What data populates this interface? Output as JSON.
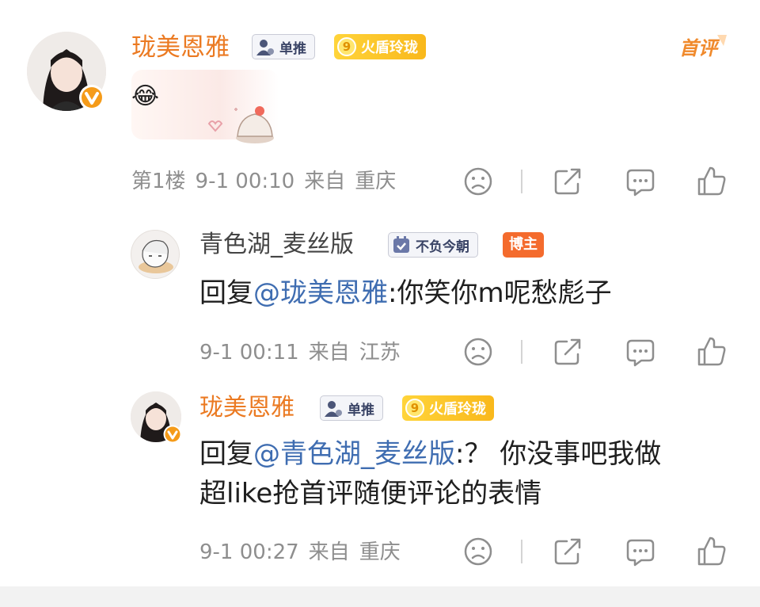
{
  "comment": {
    "username": "珑美恩雅",
    "badge_label": "单推",
    "fire_level": "9",
    "fire_label": "火盾玲珑",
    "first_tag": "首评",
    "emoji": "😂",
    "floor": "第1楼",
    "time": "9-1 00:10",
    "from_label": "来自",
    "location": "重庆"
  },
  "replies": [
    {
      "username": "青色湖_麦丝版",
      "badge_label": "不负今朝",
      "role_badge": "博主",
      "reply_prefix": "回复",
      "mention": "@珑美恩雅",
      "text": ":你笑你m呢愁彪子",
      "time": "9-1 00:11",
      "from_label": "来自",
      "location": "江苏"
    },
    {
      "username": "珑美恩雅",
      "badge_label": "单推",
      "fire_level": "9",
      "fire_label": "火盾玲珑",
      "reply_prefix": "回复",
      "mention": "@青色湖_麦丝版",
      "text_line1": ":？ 你没事吧我做",
      "text_line2": "超like抢首评随便评论的表情",
      "time": "9-1 00:27",
      "from_label": "来自",
      "location": "重庆"
    }
  ],
  "colors": {
    "username_orange": "#eb7a22",
    "mention_blue": "#3f6db1",
    "meta_gray": "#8e8e8e",
    "verified_orange": "#f59b19",
    "blogger_badge": "#f46b2d"
  },
  "icons": {
    "dislike": "sad-face-icon",
    "share": "share-icon",
    "comment": "comment-icon",
    "like": "thumbs-up-icon"
  }
}
